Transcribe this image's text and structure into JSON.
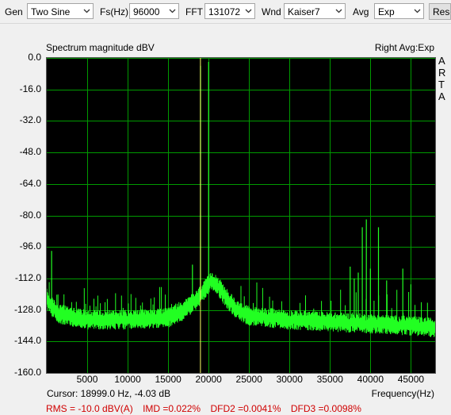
{
  "toolbar": {
    "gen_label": "Gen",
    "gen_value": "Two Sine",
    "fs_label": "Fs(Hz)",
    "fs_value": "96000",
    "fft_label": "FFT",
    "fft_value": "131072",
    "wnd_label": "Wnd",
    "wnd_value": "Kaiser7",
    "avg_label": "Avg",
    "avg_value": "Exp",
    "reset_label": "Rese"
  },
  "plot": {
    "title": "Spectrum magnitude dBV",
    "info": "Right Avg:Exp",
    "brand_letters": [
      "A",
      "R",
      "T",
      "A"
    ],
    "cursor_readout": "Cursor: 18999.0 Hz, -4.03 dB",
    "stats": {
      "rms": "RMS =  -10.0 dBV(A)",
      "imd": "IMD =0.022%",
      "dfd2": "DFD2 =0.0041%",
      "dfd3": "DFD3 =0.0098%"
    },
    "colors": {
      "background": "#000000",
      "grid": "#009a00",
      "trace": "#22ff22",
      "cursor": "#ffff66",
      "stats_text": "#d00000"
    }
  },
  "chart_data": {
    "type": "line",
    "title": "Spectrum magnitude dBV",
    "xlabel": "Frequency(Hz)",
    "ylabel": "",
    "xlim": [
      0,
      48000
    ],
    "ylim": [
      -160,
      0
    ],
    "grid": true,
    "x_ticks": [
      5000,
      10000,
      15000,
      20000,
      25000,
      30000,
      35000,
      40000,
      45000
    ],
    "x_tick_labels": [
      "5000",
      "10000",
      "15000",
      "20000",
      "25000",
      "30000",
      "35000",
      "40000",
      "45000"
    ],
    "y_ticks": [
      0,
      -16,
      -32,
      -48,
      -64,
      -80,
      -96,
      -112,
      -128,
      -144,
      -160
    ],
    "y_tick_labels": [
      "0.0",
      "-16.0",
      "-32.0",
      "-48.0",
      "-64.0",
      "-80.0",
      "-96.0",
      "-112.0",
      "-128.0",
      "-144.0",
      "-160.0"
    ],
    "cursor_x": 18999,
    "noise_floor": [
      {
        "x": 0,
        "y": -122
      },
      {
        "x": 500,
        "y": -126
      },
      {
        "x": 1500,
        "y": -130
      },
      {
        "x": 5000,
        "y": -133
      },
      {
        "x": 10000,
        "y": -133
      },
      {
        "x": 15000,
        "y": -132
      },
      {
        "x": 17000,
        "y": -128
      },
      {
        "x": 18500,
        "y": -123
      },
      {
        "x": 19500,
        "y": -118
      },
      {
        "x": 20200,
        "y": -114
      },
      {
        "x": 20500,
        "y": -113
      },
      {
        "x": 21000,
        "y": -115
      },
      {
        "x": 22000,
        "y": -121
      },
      {
        "x": 23500,
        "y": -128
      },
      {
        "x": 25000,
        "y": -131
      },
      {
        "x": 30000,
        "y": -133
      },
      {
        "x": 35000,
        "y": -134
      },
      {
        "x": 40000,
        "y": -135
      },
      {
        "x": 45000,
        "y": -136
      },
      {
        "x": 48000,
        "y": -137
      }
    ],
    "peaks": [
      {
        "x": 19000,
        "y": -4
      },
      {
        "x": 20000,
        "y": -2
      },
      {
        "x": 21000,
        "y": -116
      },
      {
        "x": 18000,
        "y": -105
      },
      {
        "x": 600,
        "y": -98
      },
      {
        "x": 37500,
        "y": -106
      },
      {
        "x": 38000,
        "y": -112
      },
      {
        "x": 38500,
        "y": -109
      },
      {
        "x": 39000,
        "y": -86
      },
      {
        "x": 39500,
        "y": -82
      },
      {
        "x": 40000,
        "y": -107
      },
      {
        "x": 41000,
        "y": -86
      },
      {
        "x": 42000,
        "y": -113
      },
      {
        "x": 44000,
        "y": -107
      },
      {
        "x": 45000,
        "y": -115
      }
    ]
  }
}
